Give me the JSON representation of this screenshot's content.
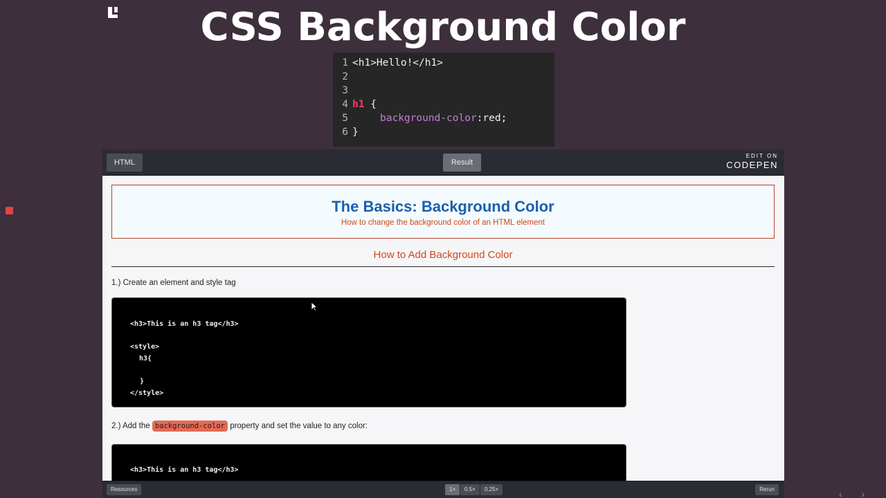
{
  "slide": {
    "title": "CSS Background Color",
    "logo_icon": "codecademy-logo-icon",
    "record_icon": "record-stop-icon"
  },
  "snippet": {
    "lines": [
      {
        "n": "1",
        "html": "<h1>Hello!</h1>"
      },
      {
        "n": "2"
      },
      {
        "n": "3"
      },
      {
        "n": "4",
        "selector": "h1",
        "brace": " {"
      },
      {
        "n": "5",
        "property": "background-color",
        "value": ":red;"
      },
      {
        "n": "6",
        "brace": "}"
      }
    ]
  },
  "codepen": {
    "tabs": {
      "html": "HTML",
      "result": "Result"
    },
    "brand": {
      "edit_on": "EDIT ON",
      "name": "CODEPEN"
    },
    "footer": {
      "resources": "Resources",
      "zoom": [
        "1×",
        "0.5×",
        "0.25×"
      ],
      "rerun": "Rerun"
    }
  },
  "result_page": {
    "header_title": "The Basics: Background Color",
    "header_subtitle": "How to change the background color of an HTML element",
    "section_title": "How to Add Background Color",
    "step1": "1.) Create an element and style tag",
    "block1": [
      "<h3>This is an h3 tag</h3>",
      "<style>",
      "h3{",
      "}",
      "</style>"
    ],
    "step2_pre": "2.) Add the",
    "step2_code": "background-color",
    "step2_post": "property and set the value to any color:",
    "block2": [
      "<h3>This is an h3 tag</h3>"
    ]
  },
  "colors": {
    "slide_bg": "#3d2f3b",
    "header_title": "#1a5fad",
    "accent_orange": "#d0471a",
    "selector_pink": "#ff3b6b",
    "property_purple": "#c77ddb"
  }
}
